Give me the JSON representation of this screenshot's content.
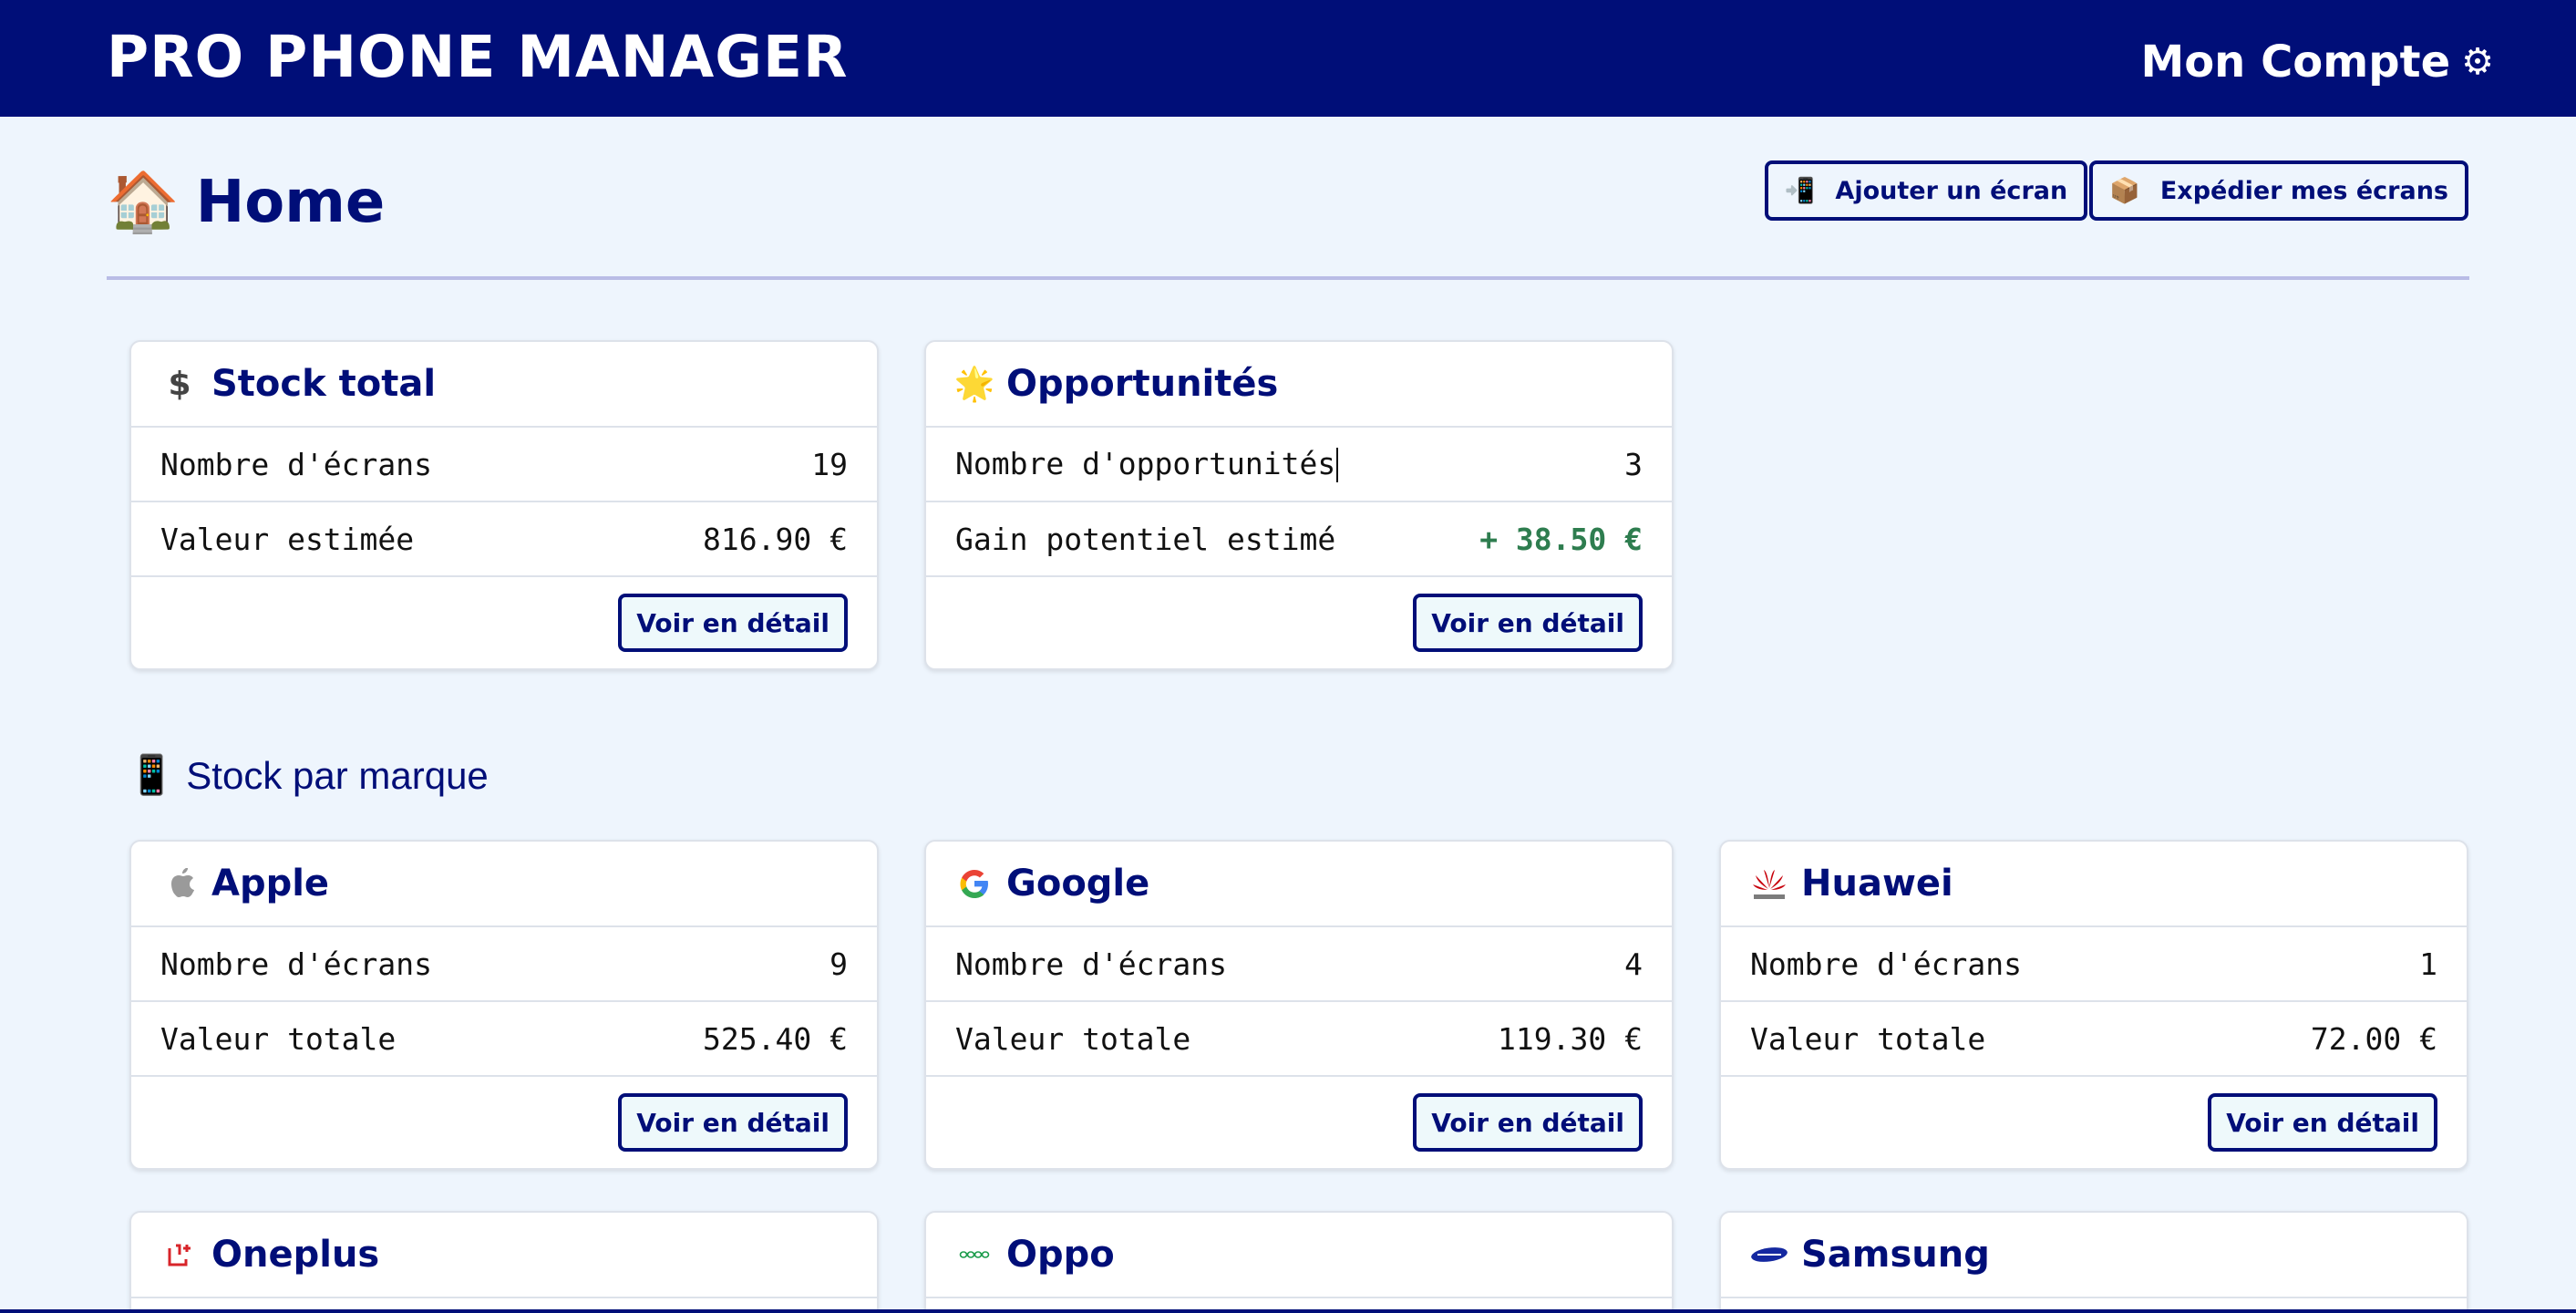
{
  "header": {
    "app_title": "PRO PHONE MANAGER",
    "account_label": "Mon Compte",
    "account_icon": "⚙"
  },
  "page": {
    "icon": "🏠",
    "title": "Home"
  },
  "actions": [
    {
      "icon": "📲",
      "label": "Ajouter un écran"
    },
    {
      "icon": "📦",
      "label": "Expédier mes écrans"
    }
  ],
  "summary_cards": [
    {
      "icon": "$",
      "title": "Stock total",
      "rows": [
        {
          "label": "Nombre d'écrans",
          "value": "19"
        },
        {
          "label": "Valeur estimée",
          "value": "816.90 €"
        }
      ],
      "button": "Voir en détail"
    },
    {
      "icon": "🌟",
      "title": "Opportunités",
      "rows": [
        {
          "label": "Nombre d'opportunités",
          "value": "3"
        },
        {
          "label": "Gain potentiel estimé",
          "value": "+ 38.50 €"
        }
      ],
      "button": "Voir en détail"
    }
  ],
  "brands_section": {
    "icon": "📱",
    "title": "Stock par marque"
  },
  "brands": [
    {
      "name": "Apple",
      "rows": [
        {
          "label": "Nombre d'écrans",
          "value": "9"
        },
        {
          "label": "Valeur totale",
          "value": "525.40 €"
        }
      ],
      "button": "Voir en détail"
    },
    {
      "name": "Google",
      "rows": [
        {
          "label": "Nombre d'écrans",
          "value": "4"
        },
        {
          "label": "Valeur totale",
          "value": "119.30 €"
        }
      ],
      "button": "Voir en détail"
    },
    {
      "name": "Huawei",
      "rows": [
        {
          "label": "Nombre d'écrans",
          "value": "1"
        },
        {
          "label": "Valeur totale",
          "value": "72.00 €"
        }
      ],
      "button": "Voir en détail"
    },
    {
      "name": "Oneplus"
    },
    {
      "name": "Oppo"
    },
    {
      "name": "Samsung"
    }
  ],
  "colors": {
    "primary": "#000e78",
    "background": "#eef5fd",
    "gain": "#2e7d4f"
  }
}
